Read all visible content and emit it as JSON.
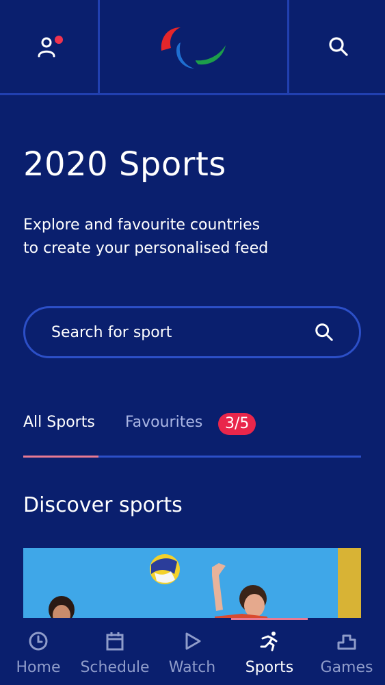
{
  "header": {
    "profile_icon": "profile-icon",
    "notification_dot_color": "#f0334f",
    "logo": "paralympics-logo",
    "search_icon": "search-icon"
  },
  "page": {
    "title": "2020 Sports",
    "subtitle_line1": "Explore and favourite countries",
    "subtitle_line2": "to create your personalised feed"
  },
  "search": {
    "placeholder": "Search for sport",
    "icon": "search-icon"
  },
  "tabs": {
    "all_label": "All Sports",
    "fav_label": "Favourites",
    "fav_badge": "3/5",
    "active": "All Sports"
  },
  "section": {
    "title": "Discover sports"
  },
  "nav": {
    "items": [
      {
        "label": "Home",
        "icon": "clock-icon"
      },
      {
        "label": "Schedule",
        "icon": "calendar-icon"
      },
      {
        "label": "Watch",
        "icon": "play-icon"
      },
      {
        "label": "Sports",
        "icon": "runner-icon"
      },
      {
        "label": "Games",
        "icon": "podium-icon"
      }
    ],
    "active": "Sports"
  },
  "colors": {
    "background": "#0a1f6e",
    "accent_blue": "#2c4fc7",
    "badge_red": "#e9264b",
    "indicator_pink": "#e87a93"
  }
}
